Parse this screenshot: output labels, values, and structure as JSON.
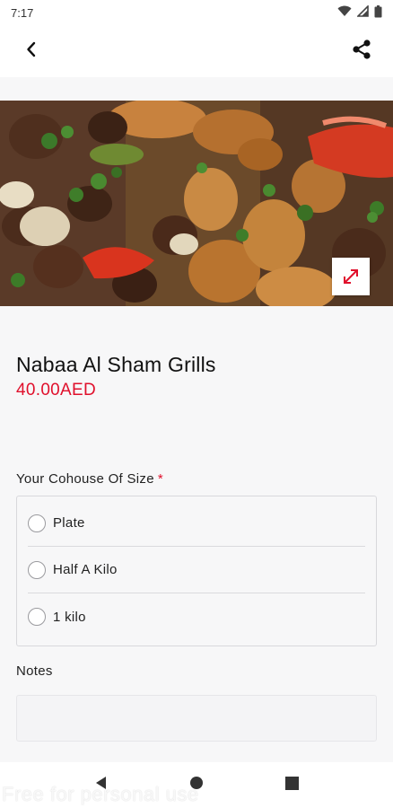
{
  "status_bar": {
    "time": "7:17",
    "icons": [
      "wifi-icon",
      "signal-icon",
      "battery-icon"
    ]
  },
  "app_bar": {
    "back_icon": "back-arrow-icon",
    "share_icon": "share-icon"
  },
  "hero": {
    "image_subject": "grilled kebabs, chicken tikka, tomatoes, onions, parsley",
    "expand_icon": "expand-icon"
  },
  "product": {
    "title": "Nabaa Al Sham Grills",
    "price": "40.00AED"
  },
  "size_section": {
    "label": "Your Cohouse Of Size",
    "required_mark": "*",
    "options": [
      {
        "label": "Plate",
        "selected": false
      },
      {
        "label": "Half A Kilo",
        "selected": false
      },
      {
        "label": "1 kilo",
        "selected": false
      }
    ]
  },
  "notes_section": {
    "label": "Notes",
    "value": ""
  },
  "nav_bar": {
    "buttons": [
      "back-triangle-icon",
      "home-circle-icon",
      "recents-square-icon"
    ]
  },
  "watermark": "Free for personal use",
  "colors": {
    "accent": "#e0102c",
    "background": "#f7f7f8",
    "surface": "#ffffff"
  }
}
